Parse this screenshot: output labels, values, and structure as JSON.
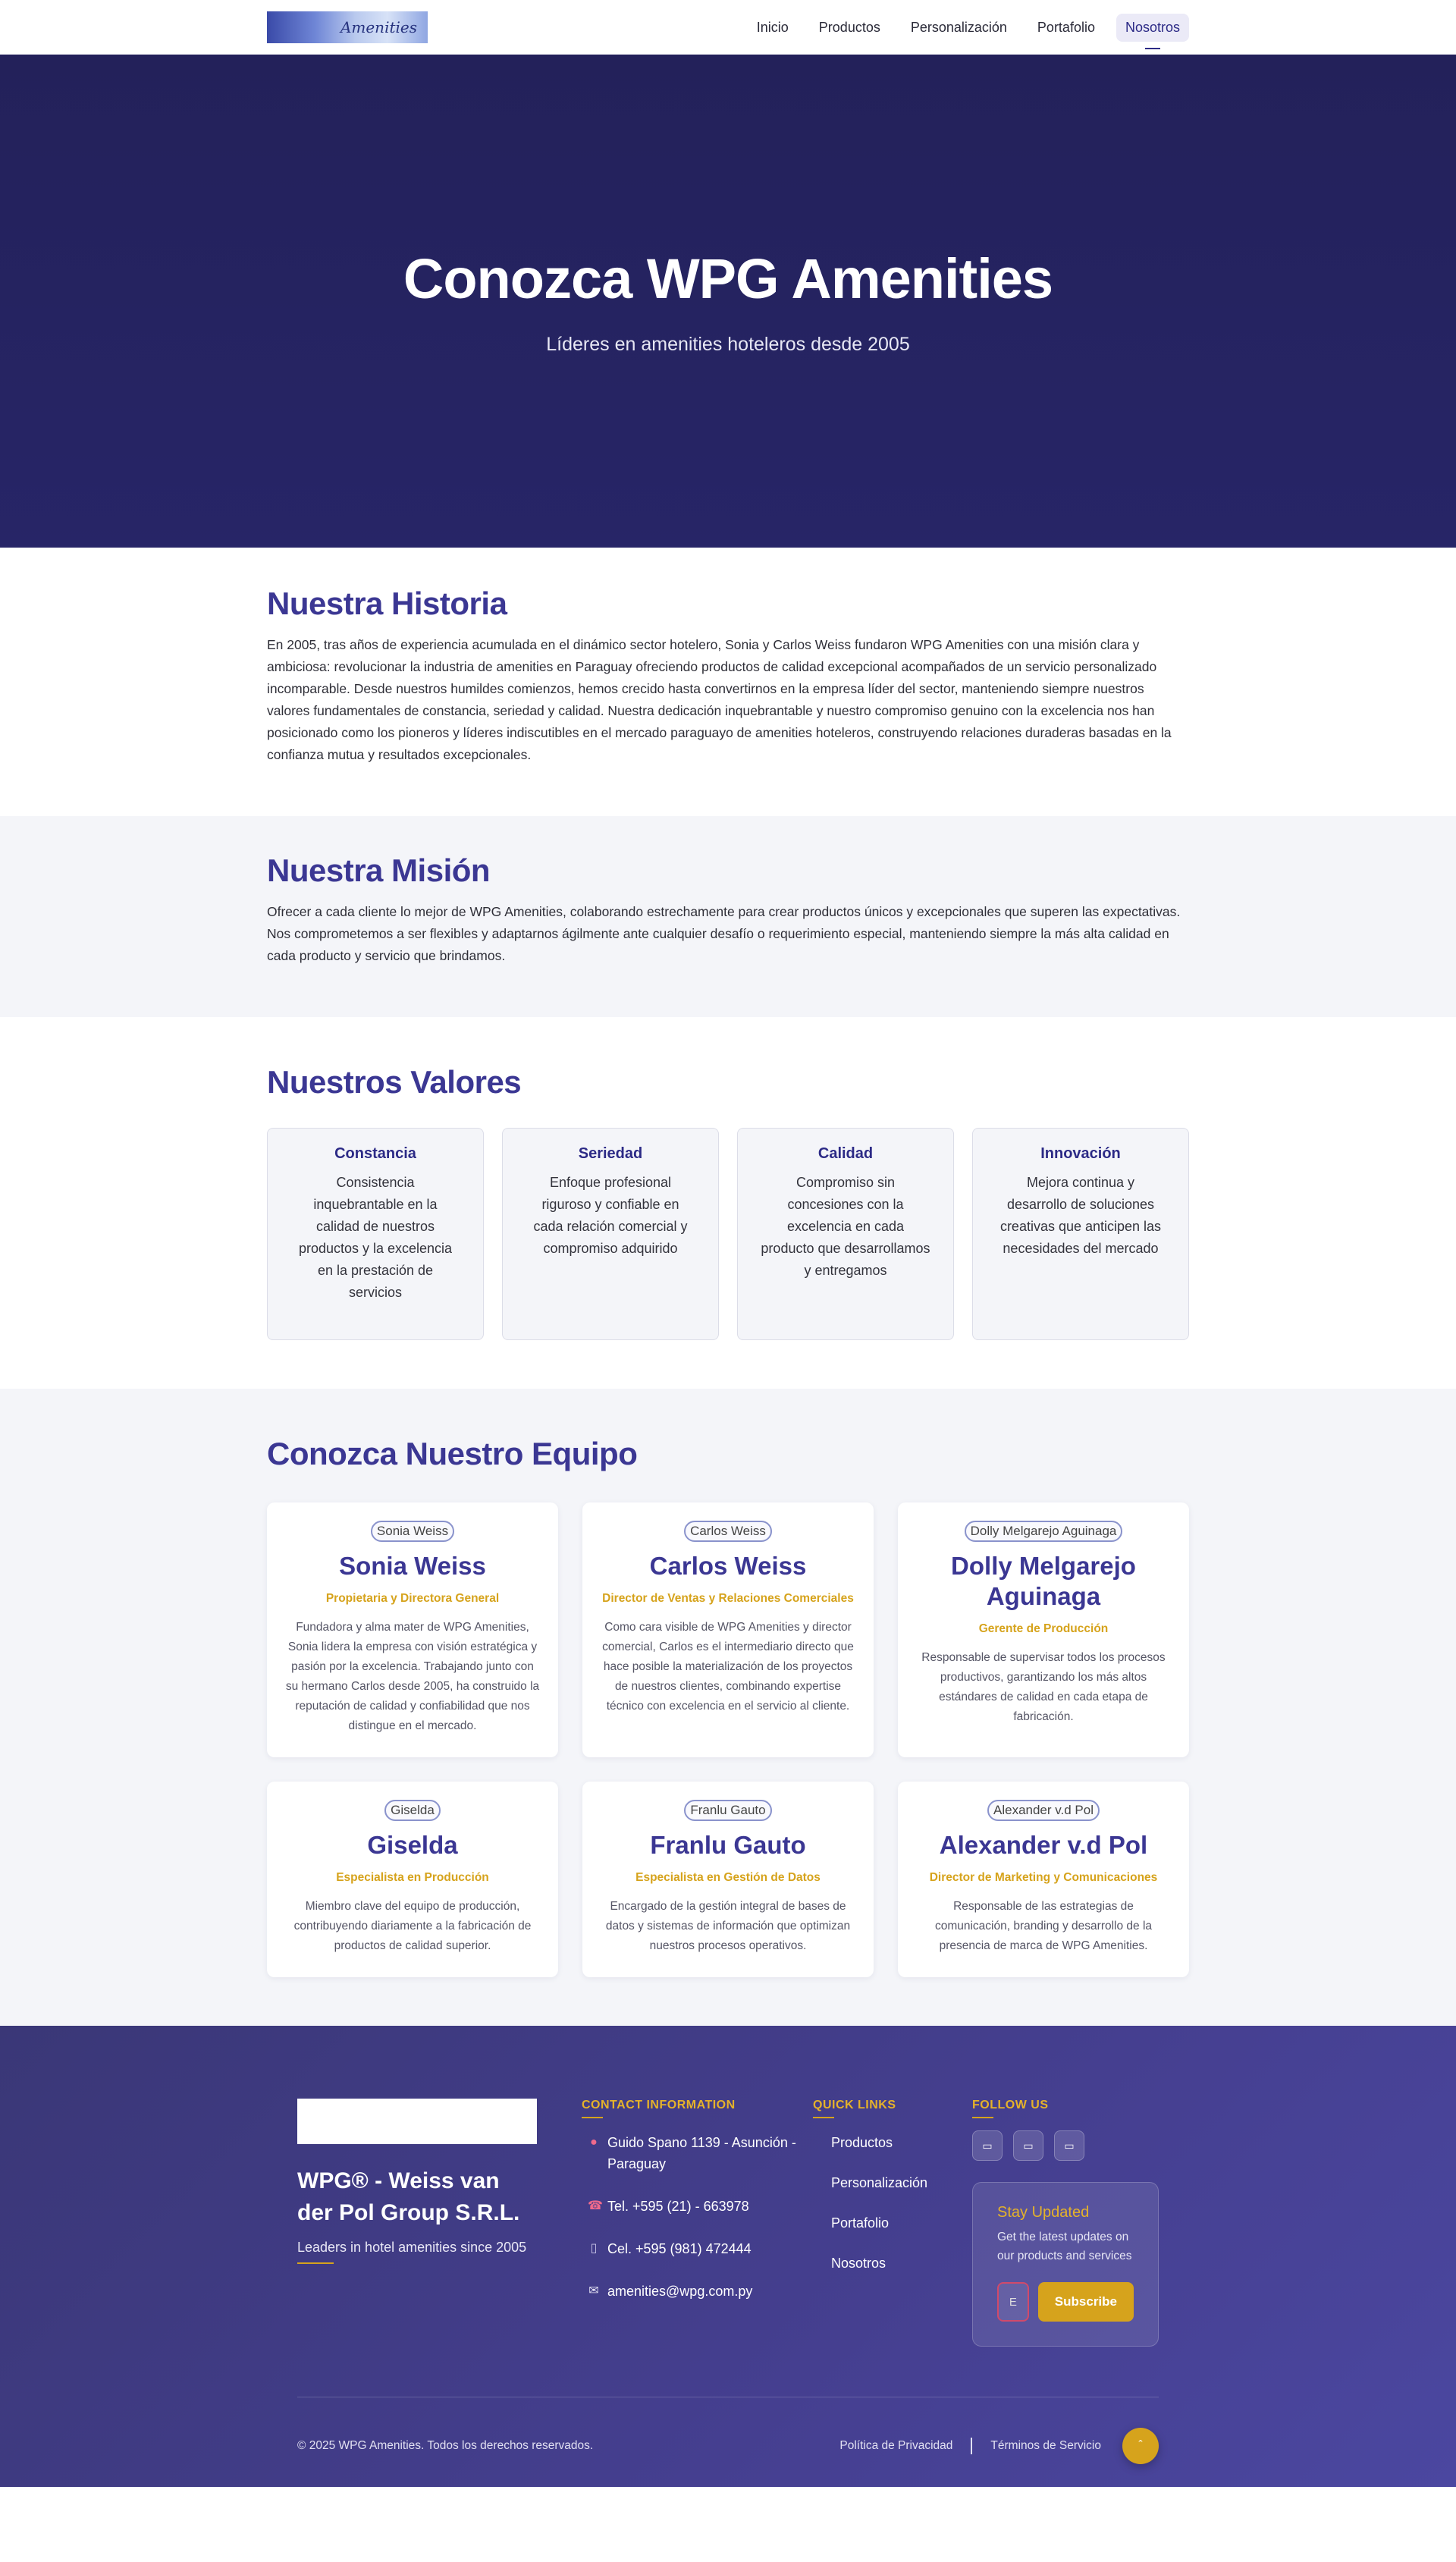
{
  "nav": {
    "logo_text": "Amenities",
    "items": [
      {
        "label": "Inicio"
      },
      {
        "label": "Productos"
      },
      {
        "label": "Personalización"
      },
      {
        "label": "Portafolio"
      },
      {
        "label": "Nosotros"
      }
    ],
    "active": "Nosotros"
  },
  "hero": {
    "title": "Conozca WPG Amenities",
    "subtitle": "Líderes en amenities hoteleros desde 2005"
  },
  "historia": {
    "title": "Nuestra Historia",
    "body": "En 2005, tras años de experiencia acumulada en el dinámico sector hotelero, Sonia y Carlos Weiss fundaron WPG Amenities con una misión clara y ambiciosa: revolucionar la industria de amenities en Paraguay ofreciendo productos de calidad excepcional acompañados de un servicio personalizado incomparable. Desde nuestros humildes comienzos, hemos crecido hasta convertirnos en la empresa líder del sector, manteniendo siempre nuestros valores fundamentales de constancia, seriedad y calidad. Nuestra dedicación inquebrantable y nuestro compromiso genuino con la excelencia nos han posicionado como los pioneros y líderes indiscutibles en el mercado paraguayo de amenities hoteleros, construyendo relaciones duraderas basadas en la confianza mutua y resultados excepcionales."
  },
  "mision": {
    "title": "Nuestra Misión",
    "body": "Ofrecer a cada cliente lo mejor de WPG Amenities, colaborando estrechamente para crear productos únicos y excepcionales que superen las expectativas. Nos comprometemos a ser flexibles y adaptarnos ágilmente ante cualquier desafío o requerimiento especial, manteniendo siempre la más alta calidad en cada producto y servicio que brindamos."
  },
  "valores": {
    "title": "Nuestros Valores",
    "items": [
      {
        "title": "Constancia",
        "text": "Consistencia inquebrantable en la calidad de nuestros productos y la excelencia en la prestación de servicios"
      },
      {
        "title": "Seriedad",
        "text": "Enfoque profesional riguroso y confiable en cada relación comercial y compromiso adquirido"
      },
      {
        "title": "Calidad",
        "text": "Compromiso sin concesiones con la excelencia en cada producto que desarrollamos y entregamos"
      },
      {
        "title": "Innovación",
        "text": "Mejora continua y desarrollo de soluciones creativas que anticipen las necesidades del mercado"
      }
    ]
  },
  "equipo": {
    "title": "Conozca Nuestro Equipo",
    "members": [
      {
        "alt": "Sonia Weiss",
        "name": "Sonia Weiss",
        "role": "Propietaria y Directora General",
        "desc": "Fundadora y alma mater de WPG Amenities, Sonia lidera la empresa con visión estratégica y pasión por la excelencia. Trabajando junto con su hermano Carlos desde 2005, ha construido la reputación de calidad y confiabilidad que nos distingue en el mercado."
      },
      {
        "alt": "Carlos Weiss",
        "name": "Carlos Weiss",
        "role": "Director de Ventas y Relaciones Comerciales",
        "desc": "Como cara visible de WPG Amenities y director comercial, Carlos es el intermediario directo que hace posible la materialización de los proyectos de nuestros clientes, combinando expertise técnico con excelencia en el servicio al cliente."
      },
      {
        "alt": "Dolly Melgarejo Aguinaga",
        "name": "Dolly Melgarejo Aguinaga",
        "role": "Gerente de Producción",
        "desc": "Responsable de supervisar todos los procesos productivos, garantizando los más altos estándares de calidad en cada etapa de fabricación."
      },
      {
        "alt": "Giselda",
        "name": "Giselda",
        "role": "Especialista en Producción",
        "desc": "Miembro clave del equipo de producción, contribuyendo diariamente a la fabricación de productos de calidad superior."
      },
      {
        "alt": "Franlu Gauto",
        "name": "Franlu Gauto",
        "role": "Especialista en Gestión de Datos",
        "desc": "Encargado de la gestión integral de bases de datos y sistemas de información que optimizan nuestros procesos operativos."
      },
      {
        "alt": "Alexander v.d Pol",
        "name": "Alexander v.d Pol",
        "role": "Director de Marketing y Comunicaciones",
        "desc": "Responsable de las estrategias de comunicación, branding y desarrollo de la presencia de marca de WPG Amenities."
      }
    ]
  },
  "footer": {
    "company": "WPG® - Weiss van der Pol Group S.R.L.",
    "tagline": "Leaders in hotel amenities since 2005",
    "contact_title": "CONTACT INFORMATION",
    "contact": [
      {
        "icon": "location-pin-icon",
        "text": "Guido Spano 1139 - Asunción - Paraguay"
      },
      {
        "icon": "phone-icon",
        "text": "Tel. +595 (21) - 663978"
      },
      {
        "icon": "mobile-icon",
        "text": "Cel. +595 (981) 472444"
      },
      {
        "icon": "mail-icon",
        "text": "amenities@wpg.com.py"
      }
    ],
    "links_title": "QUICK LINKS",
    "links": [
      {
        "label": "Productos"
      },
      {
        "label": "Personalización"
      },
      {
        "label": "Portafolio"
      },
      {
        "label": "Nosotros"
      }
    ],
    "follow_title": "FOLLOW US",
    "socials": [
      "social-icon-1",
      "social-icon-2",
      "social-icon-3"
    ],
    "newsletter": {
      "title": "Stay Updated",
      "text": "Get the latest updates on our products and services",
      "placeholder": "E",
      "button": "Subscribe"
    },
    "copyright": "© 2025 WPG Amenities. Todos los derechos reservados.",
    "privacy": "Política de Privacidad",
    "terms": "Términos de Servicio"
  },
  "colors": {
    "primary": "#3b3793",
    "hero_bg": "#23215a",
    "accent": "#d6a31c",
    "section_gray": "#f4f5f9"
  }
}
